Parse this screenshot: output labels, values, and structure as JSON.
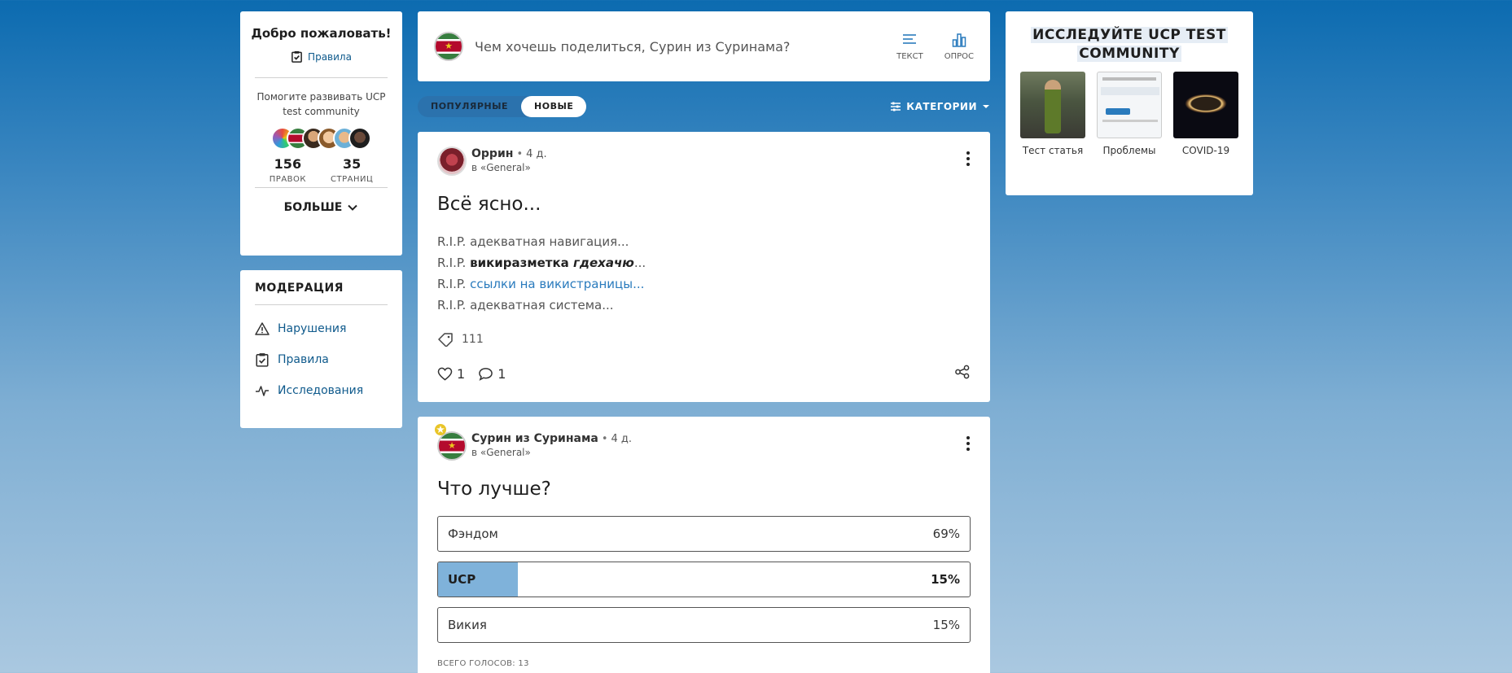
{
  "welcome": {
    "title": "Добро пожаловать!",
    "rules_link": "Правила",
    "help_text": "Помогите развивать UCP test community",
    "edits_count": "156",
    "edits_label": "ПРАВОК",
    "pages_count": "35",
    "pages_label": "СТРАНИЦ",
    "more_label": "БОЛЬШЕ"
  },
  "moderation": {
    "title": "МОДЕРАЦИЯ",
    "items": [
      {
        "label": "Нарушения",
        "icon": "warning-icon"
      },
      {
        "label": "Правила",
        "icon": "clipboard-check-icon"
      },
      {
        "label": "Исследования",
        "icon": "activity-icon"
      }
    ]
  },
  "composer": {
    "placeholder": "Чем хочешь поделиться, Сурин из Суринама?",
    "text_label": "ТЕКСТ",
    "poll_label": "ОПРОС"
  },
  "filter": {
    "popular": "ПОПУЛЯРНЫЕ",
    "new": "НОВЫЕ",
    "categories": "КАТЕГОРИИ"
  },
  "posts": [
    {
      "author": "Оррин",
      "time": "4 д.",
      "where": "в «General»",
      "title": "Всё ясно...",
      "lines": {
        "l1": "R.I.P. адекватная навигация...",
        "l2_prefix": "R.I.P. ",
        "l2_bold": "викиразметка ",
        "l2_bolditalic": "гдехачю",
        "l2_suffix": "...",
        "l3_prefix": "R.I.P. ",
        "l3_link": "ссылки на викистраницы",
        "l3_suffix": "...",
        "l4": "R.I.P. адекватная система..."
      },
      "tag": "111",
      "likes": "1",
      "comments": "1"
    },
    {
      "author": "Сурин из Суринама",
      "time": "4 д.",
      "where": "в «General»",
      "title": "Что лучше?",
      "options": [
        {
          "label": "Фэндом",
          "percent": "69%",
          "share": 0
        },
        {
          "label": "UCP",
          "percent": "15%",
          "share": 0.15
        },
        {
          "label": "Викия",
          "percent": "15%",
          "share": 0
        }
      ],
      "total_votes": "ВСЕГО ГОЛОСОВ: 13"
    }
  ],
  "explore": {
    "title_line1": "ИССЛЕДУЙТЕ UCP TEST",
    "title_line2": "COMMUNITY",
    "items": [
      {
        "caption": "Тест статья"
      },
      {
        "caption": "Проблемы"
      },
      {
        "caption": "COVID-19"
      }
    ]
  }
}
